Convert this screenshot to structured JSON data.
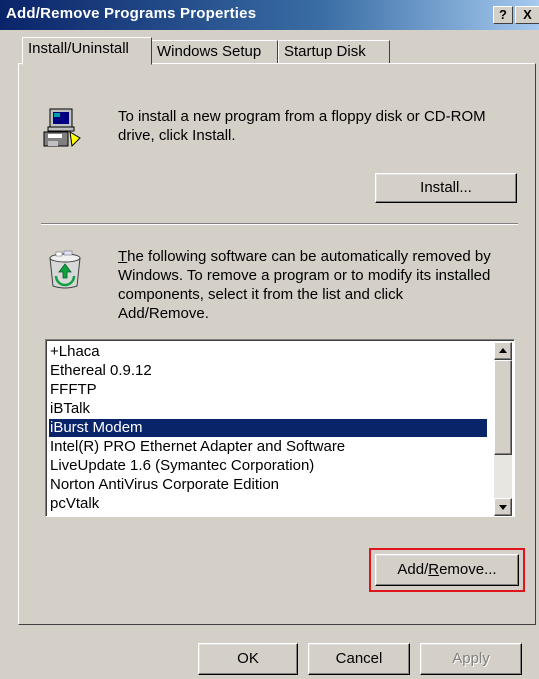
{
  "window": {
    "title": "Add/Remove Programs Properties",
    "help_btn": "?",
    "close_btn": "X"
  },
  "tabs": [
    {
      "label": "Install/Uninstall",
      "active": true
    },
    {
      "label": "Windows Setup",
      "active": false
    },
    {
      "label": "Startup Disk",
      "active": false
    }
  ],
  "install_section": {
    "icon": "floppy-computer-icon",
    "text_line1": "To install a new program from a floppy disk or CD-ROM",
    "text_line2": "drive, click Install.",
    "install_button": "Install..."
  },
  "remove_section": {
    "icon": "recycle-bin-icon",
    "text_lines": [
      "The following software can be automatically removed by",
      "Windows. To remove a program or to modify its installed",
      "components, select it from the list and click",
      "Add/Remove."
    ],
    "programs": [
      "+Lhaca",
      "Ethereal 0.9.12",
      "FFFTP",
      "iBTalk",
      "iBurst  Modem",
      "Intel(R) PRO Ethernet Adapter and Software",
      "LiveUpdate 1.6 (Symantec Corporation)",
      "Norton AntiVirus Corporate Edition",
      "pcVtalk"
    ],
    "selected_program": "iBurst  Modem",
    "add_remove_button": "Add/Remove..."
  },
  "footer": {
    "ok": "OK",
    "cancel": "Cancel",
    "apply": "Apply"
  },
  "colors": {
    "selection": "#0a246a",
    "highlight_box": "#e0141c",
    "titlebar_start": "#0a246a"
  }
}
